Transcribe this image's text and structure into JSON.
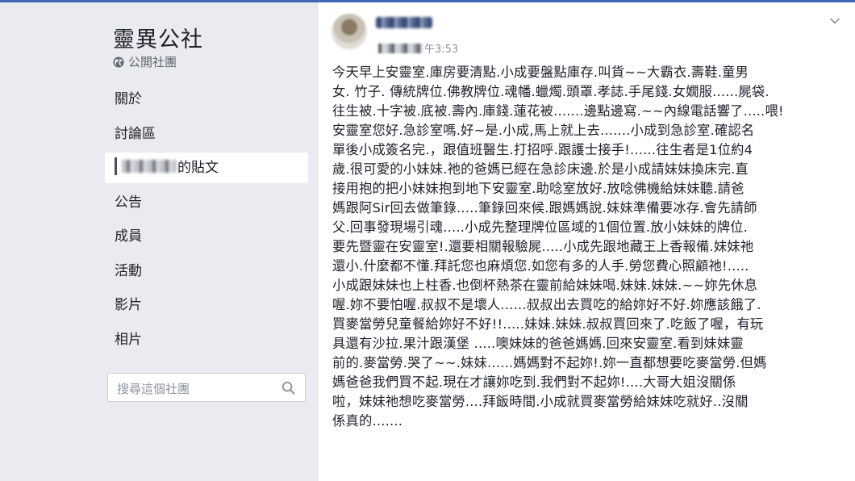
{
  "group": {
    "name": "靈異公社",
    "privacy": "公開社團"
  },
  "nav": {
    "about": "關於",
    "discussion": "討論區",
    "my_posts_suffix": "的貼文",
    "announcements": "公告",
    "members": "成員",
    "events": "活動",
    "videos": "影片",
    "photos": "相片"
  },
  "search": {
    "placeholder": "搜尋這個社團"
  },
  "post": {
    "time": "午3:53",
    "lines": [
      "今天早上安靈室.庫房要清點.小成要盤點庫存.叫貨~~大霸衣.壽鞋.童男",
      "女. 竹子. 傳統牌位.佛教牌位.魂幡.蠟燭.頭罩.孝誌.手尾錢.女嫺服......屍袋.",
      "往生被.十字被.底被.壽內.庫錢.蓮花被.......邊點邊寫.~~內線電話響了.....喂!",
      "安靈室您好.急診室嗎.好~是.小成,馬上就上去.......小成到急診室.確認名",
      "單後小成簽名完.，跟值班醫生.打招呼.跟護士接手!......往生者是1位約4",
      "歲.很可愛的小妹妹.祂的爸媽已經在急診床邊.於是小成請妹妹換床完.直",
      "接用抱的把小妹妹抱到地下安靈室.助唸室放好.放唸佛機給妹妹聽.請爸",
      "媽跟阿Sir回去做筆錄.....筆錄回來候.跟媽媽說.妹妹準備要冰存.會先請師",
      "父.回事發現場引魂.....小成先整理牌位區域的1個位置.放小妹妹的牌位.",
      "要先暨靈在安靈室!.還要相關報驗屍.....小成先跟地藏王上香報備.妹妹祂",
      "還小.什麼都不懂.拜託您也麻煩您.如您有多的人手.勞您費心照顧祂!.....",
      "小成跟妹妹也上柱香.也倒杯熱茶在靈前給妹妹喝.妹妹.妹妹.~~妳先休息",
      "喔.妳不要怕喔.叔叔不是壞人......叔叔出去買吃的給妳好不好.妳應該餓了.",
      "買麥當勞兒童餐給妳好不好!!.....妹妹.妹妹.叔叔買回來了.吃飯了喔，有玩",
      "具還有沙拉.果汁跟漢堡 .....噢妹妹的爸爸媽媽.回來安靈室.看到妹妹靈",
      "前的.麥當勞.哭了~~.妹妹......媽媽對不起妳!.妳一直都想要吃麥當勞.但媽",
      "媽爸爸我們買不起.現在才讓妳吃到.我們對不起妳!....大哥大姐沒關係",
      "啦，妹妹祂想吃麥當勞....拜飯時間.小成就買麥當勞給妹妹吃就好..沒關",
      "係真的......."
    ]
  },
  "colors": {
    "brand": "#4267b2",
    "page_bg": "#e9ebee",
    "muted_text": "#606770"
  },
  "icons": {
    "privacy": "globe-icon",
    "search": "search-icon",
    "post_menu": "chevron-down-icon"
  }
}
